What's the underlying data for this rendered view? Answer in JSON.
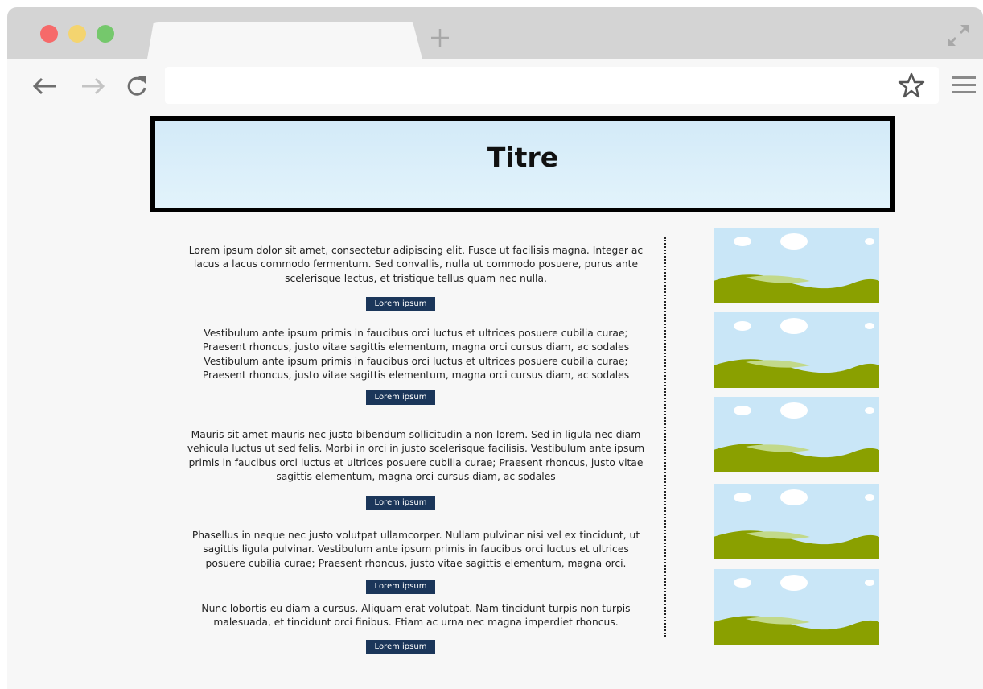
{
  "browser": {
    "tab_title": "",
    "address_value": "",
    "icons": {
      "back": "back-arrow-icon",
      "forward": "forward-arrow-icon",
      "reload": "reload-icon",
      "new_tab": "plus-icon",
      "bookmark": "star-icon",
      "menu": "hamburger-menu-icon",
      "fullscreen": "expand-icon"
    },
    "colors": {
      "close": "#f66a6a",
      "minimize": "#f4d46f",
      "maximize": "#75c86c"
    }
  },
  "page": {
    "title": "Titre",
    "sections": [
      {
        "text": "Lorem ipsum dolor sit amet, consectetur adipiscing elit. Fusce ut facilisis magna. Integer ac lacus a lacus commodo fermentum. Sed convallis, nulla ut commodo posuere, purus ante scelerisque lectus, et tristique tellus quam nec nulla.",
        "button": "Lorem ipsum"
      },
      {
        "text": "Vestibulum ante ipsum primis in faucibus orci luctus et ultrices posuere cubilia curae; Praesent rhoncus, justo vitae sagittis elementum, magna orci cursus diam, ac sodales Vestibulum ante ipsum primis in faucibus orci luctus et ultrices posuere cubilia curae; Praesent rhoncus, justo vitae sagittis elementum, magna orci cursus diam, ac sodales",
        "button": "Lorem ipsum"
      },
      {
        "text": "Mauris sit amet mauris nec justo bibendum sollicitudin a non lorem. Sed in ligula nec diam vehicula luctus ut sed felis. Morbi in orci in justo scelerisque facilisis. Vestibulum ante ipsum primis in faucibus orci luctus et ultrices posuere cubilia curae; Praesent rhoncus, justo vitae sagittis elementum, magna orci cursus diam, ac sodales",
        "button": "Lorem ipsum"
      },
      {
        "text": "Phasellus in neque nec justo volutpat ullamcorper. Nullam pulvinar nisi vel ex tincidunt, ut sagittis ligula pulvinar. Vestibulum ante ipsum primis in faucibus orci luctus et ultrices posuere cubilia curae; Praesent rhoncus, justo vitae sagittis elementum, magna orci.",
        "button": "Lorem ipsum"
      },
      {
        "text": "Nunc lobortis eu diam a cursus. Aliquam erat volutpat. Nam tincidunt turpis non turpis malesuada, et tincidunt orci finibus. Etiam ac urna nec magna imperdiet rhoncus.",
        "button": "Lorem ipsum"
      }
    ],
    "images": [
      "landscape-image",
      "landscape-image",
      "landscape-image",
      "landscape-image",
      "landscape-image"
    ],
    "colors": {
      "button_bg": "#1b365a",
      "sky": "#c9e6f7",
      "hill": "#8aa000",
      "hill_light": "#c2d98a"
    }
  }
}
